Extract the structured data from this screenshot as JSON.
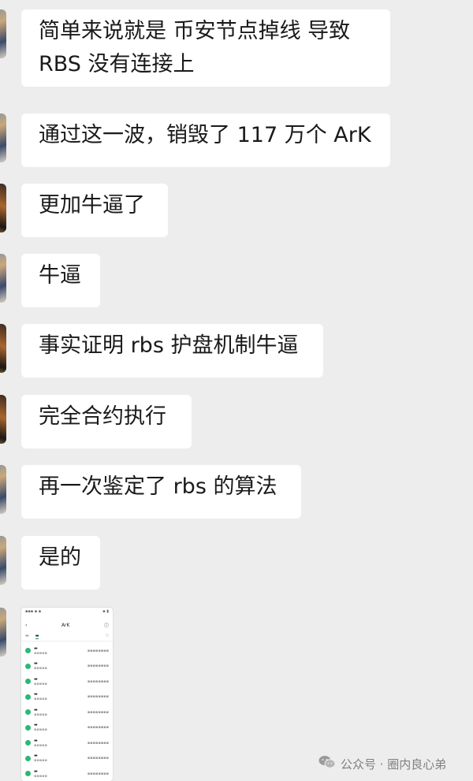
{
  "messages": [
    {
      "lines": [
        "简单来说就是 币安节点掉线 导致",
        "RBS 没有连接上"
      ]
    },
    {
      "lines": [
        "通过这一波，销毁了 117 万个 ArK"
      ]
    },
    {
      "lines": [
        "更加牛逼了"
      ]
    },
    {
      "lines": [
        "牛逼"
      ]
    },
    {
      "lines": [
        "事实证明 rbs 护盘机制牛逼"
      ]
    },
    {
      "lines": [
        "完全合约执行"
      ]
    },
    {
      "lines": [
        "再一次鉴定了 rbs 的算法"
      ]
    },
    {
      "lines": [
        "是的"
      ]
    }
  ],
  "screenshot_thumb": {
    "title": "ArK"
  },
  "watermark": {
    "text": "公众号 · 圈内良心弟",
    "icon": "wechat-icon"
  }
}
